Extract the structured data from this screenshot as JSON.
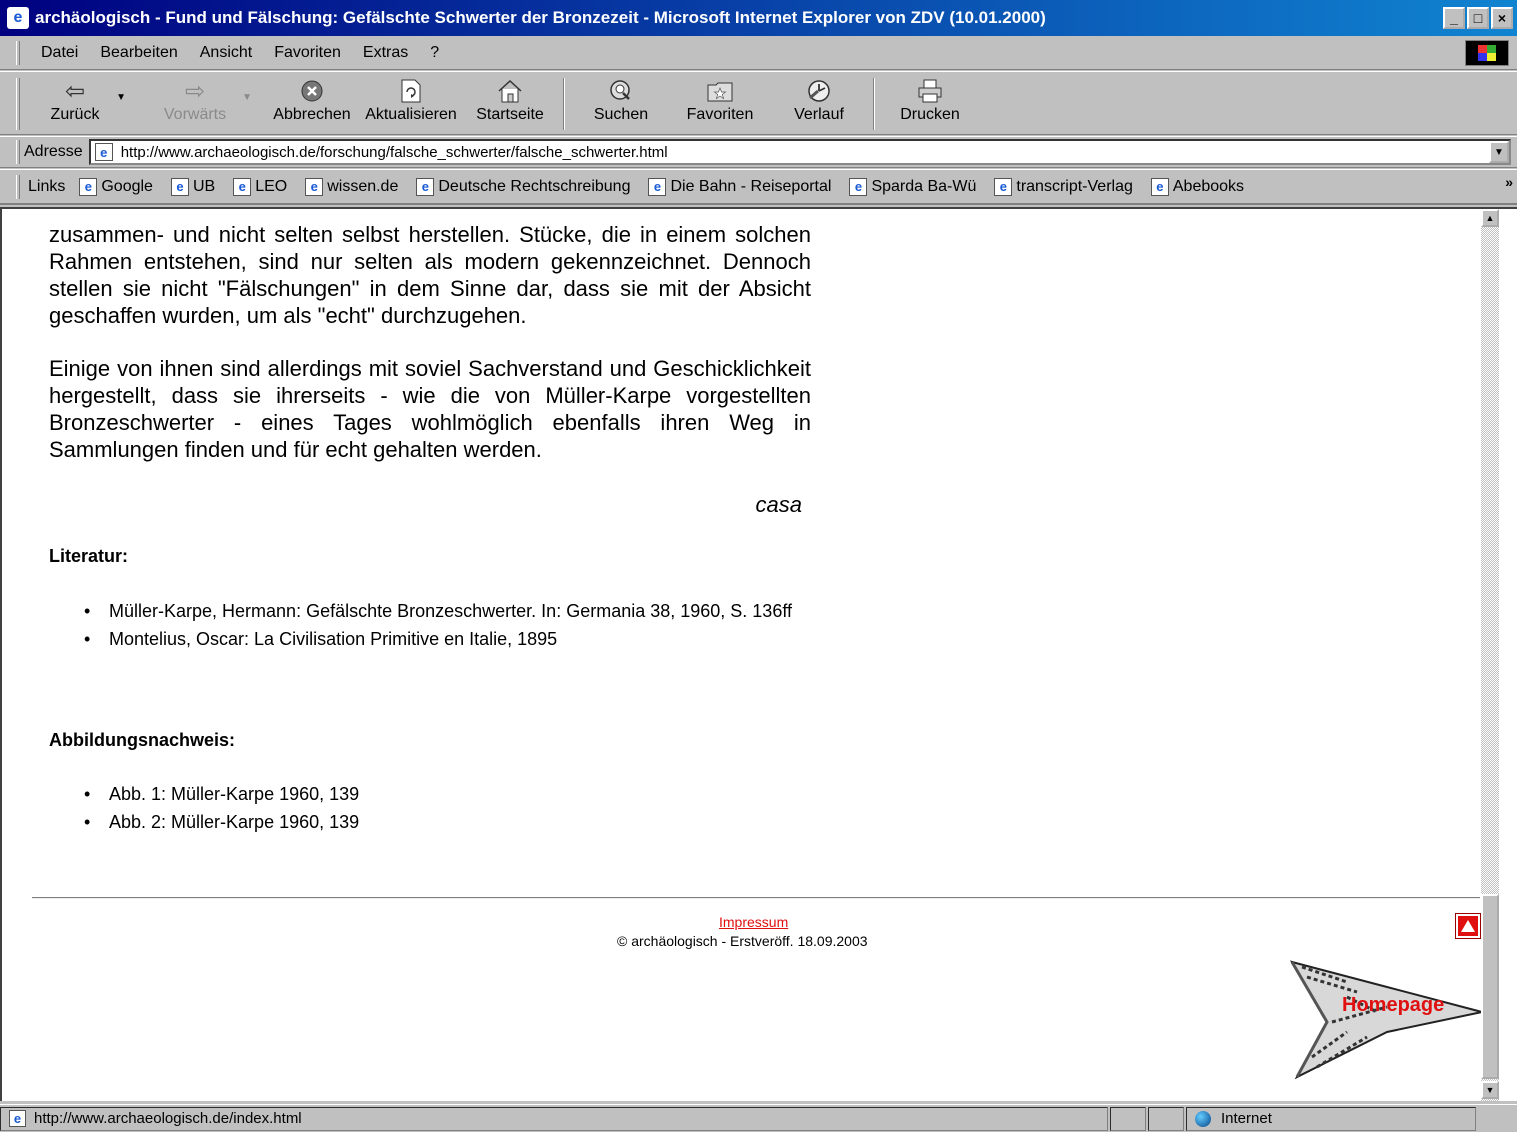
{
  "window": {
    "title": "archäologisch - Fund und Fälschung: Gefälschte Schwerter der Bronzezeit - Microsoft Internet Explorer von ZDV (10.01.2000)",
    "minimize": "_",
    "maximize": "□",
    "close": "×"
  },
  "menu": [
    "Datei",
    "Bearbeiten",
    "Ansicht",
    "Favoriten",
    "Extras",
    "?"
  ],
  "toolbar": {
    "back": "Zurück",
    "forward": "Vorwärts",
    "stop": "Abbrechen",
    "refresh": "Aktualisieren",
    "home": "Startseite",
    "search": "Suchen",
    "favorites": "Favoriten",
    "history": "Verlauf",
    "print": "Drucken"
  },
  "address": {
    "label": "Adresse",
    "url": "http://www.archaeologisch.de/forschung/falsche_schwerter/falsche_schwerter.html"
  },
  "links": {
    "label": "Links",
    "items": [
      "Google",
      "UB",
      "LEO",
      "wissen.de",
      "Deutsche Rechtschreibung",
      "Die Bahn - Reiseportal",
      "Sparda Ba-Wü",
      "transcript-Verlag",
      "Abebooks"
    ],
    "more": "»"
  },
  "content": {
    "paragraph1": "zusammen- und nicht selten selbst herstellen. Stücke, die in einem solchen Rahmen entstehen, sind nur selten als modern gekennzeichnet. Dennoch stellen sie nicht \"Fälschungen\" in dem Sinne dar, dass sie mit der Absicht geschaffen wurden, um als \"echt\" durchzugehen.",
    "paragraph2": "Einige von ihnen sind allerdings mit soviel Sachverstand und Geschicklichkeit hergestellt, dass sie ihrerseits - wie die von Müller-Karpe vorgestellten Bronzeschwerter - eines Tages wohlmöglich ebenfalls ihren Weg in Sammlungen finden und für echt gehalten werden.",
    "author": "casa",
    "literature_heading": "Literatur:",
    "literature": [
      "Müller-Karpe, Hermann: Gefälschte Bronzeschwerter. In: Germania 38, 1960, S. 136ff",
      "Montelius, Oscar: La Civilisation Primitive en Italie, 1895"
    ],
    "figures_heading": "Abbildungsnachweis:",
    "figures": [
      "Abb. 1: Müller-Karpe 1960, 139",
      "Abb. 2: Müller-Karpe 1960, 139"
    ],
    "impressum": "Impressum",
    "copyright": "© archäologisch - Erstveröff. 18.09.2003",
    "homepage": "Homepage"
  },
  "status": {
    "url": "http://www.archaeologisch.de/index.html",
    "zone": "Internet"
  },
  "colors": {
    "titlebar": "#000080",
    "accent_red": "#e01010",
    "chrome": "#c0c0c0"
  }
}
